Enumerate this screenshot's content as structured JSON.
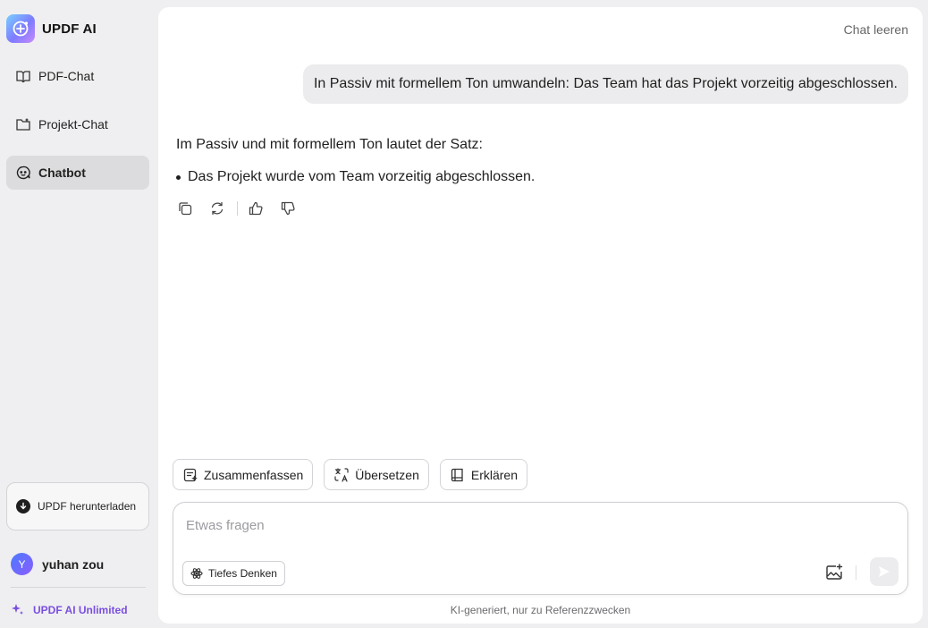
{
  "brand": {
    "name": "UPDF AI",
    "logo_icon": "updf-ai-logo-icon"
  },
  "sidebar": {
    "items": [
      {
        "label": "PDF-Chat",
        "icon": "open-book-icon",
        "active": false
      },
      {
        "label": "Projekt-Chat",
        "icon": "folder-icon",
        "active": false
      },
      {
        "label": "Chatbot",
        "icon": "chatbot-icon",
        "active": true
      }
    ],
    "download_label": "UPDF herunterladen",
    "user": {
      "initial": "Y",
      "name": "yuhan zou"
    },
    "unlimited_label": "UPDF AI Unlimited"
  },
  "main": {
    "clear_chat_label": "Chat leeren",
    "user_message": "In Passiv mit formellem Ton umwandeln: Das Team hat das Projekt vorzeitig abgeschlossen.",
    "answer": {
      "intro": "Im Passiv und mit formellem Ton lautet der Satz:",
      "bullets": [
        "Das Projekt wurde vom Team vorzeitig abgeschlossen."
      ]
    },
    "quick_actions": [
      {
        "label": "Zusammenfassen",
        "icon": "summary-icon"
      },
      {
        "label": "Übersetzen",
        "icon": "translate-icon"
      },
      {
        "label": "Erklären",
        "icon": "book-icon"
      }
    ],
    "composer": {
      "placeholder": "Etwas fragen",
      "value": "",
      "deep_think_label": "Tiefes Denken"
    },
    "disclaimer": "KI-generiert, nur zu Referenzzwecken"
  },
  "colors": {
    "accent": "#7a4fe0",
    "active_nav": "#dcdcde",
    "background": "#efeff1"
  }
}
